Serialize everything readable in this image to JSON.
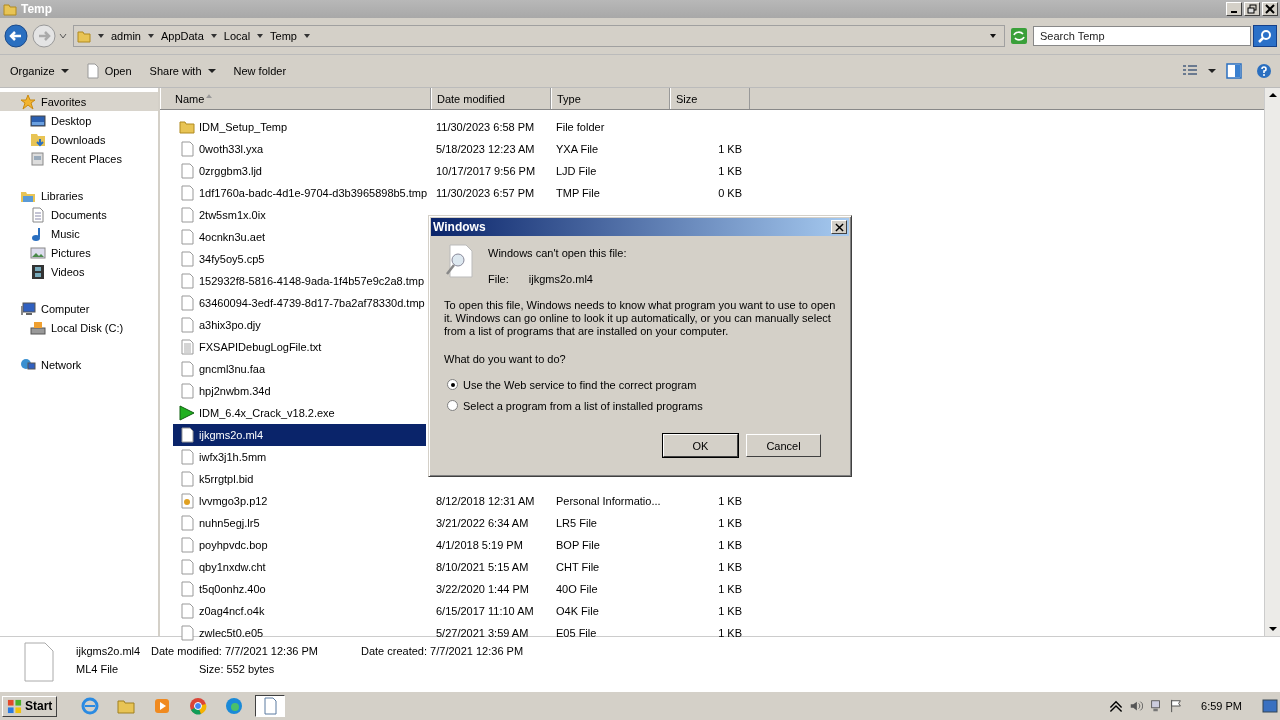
{
  "window": {
    "title": "Temp"
  },
  "address": {
    "crumbs": [
      "admin",
      "AppData",
      "Local",
      "Temp"
    ],
    "search_placeholder": "Search Temp"
  },
  "toolbar": [
    {
      "label": "Organize",
      "kind": "menu"
    },
    {
      "label": "Open",
      "kind": "open"
    },
    {
      "label": "Share with",
      "kind": "menu"
    },
    {
      "label": "New folder",
      "kind": "plain"
    }
  ],
  "sidebar": [
    {
      "label": "Favorites",
      "kind": "favorites",
      "selected": true,
      "children": [
        {
          "label": "Desktop",
          "kind": "desktop",
          "selected": false
        },
        {
          "label": "Downloads",
          "kind": "downloads",
          "selected": false
        },
        {
          "label": "Recent Places",
          "kind": "recent",
          "selected": false
        }
      ]
    },
    {
      "label": "Libraries",
      "kind": "libraries",
      "selected": false,
      "children": [
        {
          "label": "Documents",
          "kind": "documents",
          "selected": false
        },
        {
          "label": "Music",
          "kind": "music",
          "selected": false
        },
        {
          "label": "Pictures",
          "kind": "pictures",
          "selected": false
        },
        {
          "label": "Videos",
          "kind": "videos",
          "selected": false
        }
      ]
    },
    {
      "label": "Computer",
      "kind": "computer",
      "selected": false,
      "children": [
        {
          "label": "Local Disk (C:)",
          "kind": "disk",
          "selected": false
        }
      ]
    },
    {
      "label": "Network",
      "kind": "network",
      "selected": false
    }
  ],
  "table": {
    "columns": [
      "Name",
      "Date modified",
      "Type",
      "Size"
    ],
    "rows": [
      {
        "name": "IDM_Setup_Temp",
        "kind": "folder",
        "date": "11/30/2023 6:58 PM",
        "type": "File folder",
        "selected": false
      },
      {
        "name": "0woth33l.yxa",
        "kind": "file",
        "date": "5/18/2023 12:23 AM",
        "type": "YXA File",
        "size": "1 KB",
        "selected": false
      },
      {
        "name": "0zrggbm3.ljd",
        "kind": "file",
        "date": "10/17/2017 9:56 PM",
        "type": "LJD File",
        "size": "1 KB",
        "selected": false
      },
      {
        "name": "1df1760a-badc-4d1e-9704-d3b3965898b5.tmp",
        "kind": "file",
        "date": "11/30/2023 6:57 PM",
        "type": "TMP File",
        "size": "0 KB",
        "selected": false
      },
      {
        "name": "2tw5sm1x.0ix",
        "kind": "file",
        "selected": false
      },
      {
        "name": "4ocnkn3u.aet",
        "kind": "file",
        "selected": false
      },
      {
        "name": "34fy5oy5.cp5",
        "kind": "file",
        "selected": false
      },
      {
        "name": "152932f8-5816-4148-9ada-1f4b57e9c2a8.tmp",
        "kind": "file",
        "selected": false
      },
      {
        "name": "63460094-3edf-4739-8d17-7ba2af78330d.tmp",
        "kind": "file",
        "selected": false
      },
      {
        "name": "a3hix3po.djy",
        "kind": "file",
        "selected": false
      },
      {
        "name": "FXSAPIDebugLogFile.txt",
        "kind": "text",
        "selected": false
      },
      {
        "name": "gncml3nu.faa",
        "kind": "file",
        "selected": false
      },
      {
        "name": "hpj2nwbm.34d",
        "kind": "file",
        "selected": false
      },
      {
        "name": "IDM_6.4x_Crack_v18.2.exe",
        "kind": "exe",
        "selected": false
      },
      {
        "name": "ijkgms2o.ml4",
        "kind": "file",
        "selected": true
      },
      {
        "name": "iwfx3j1h.5mm",
        "kind": "file",
        "selected": false
      },
      {
        "name": "k5rrgtpl.bid",
        "kind": "file",
        "selected": false
      },
      {
        "name": "lvvmgo3p.p12",
        "kind": "cert",
        "date": "8/12/2018 12:31 AM",
        "type": "Personal Informatio...",
        "size": "1 KB",
        "selected": false
      },
      {
        "name": "nuhn5egj.lr5",
        "kind": "file",
        "date": "3/21/2022 6:34 AM",
        "type": "LR5 File",
        "size": "1 KB",
        "selected": false
      },
      {
        "name": "poyhpvdc.bop",
        "kind": "file",
        "date": "4/1/2018 5:19 PM",
        "type": "BOP File",
        "size": "1 KB",
        "selected": false
      },
      {
        "name": "qby1nxdw.cht",
        "kind": "file",
        "date": "8/10/2021 5:15 AM",
        "type": "CHT File",
        "size": "1 KB",
        "selected": false
      },
      {
        "name": "t5q0onhz.40o",
        "kind": "file",
        "date": "3/22/2020 1:44 PM",
        "type": "40O File",
        "size": "1 KB",
        "selected": false
      },
      {
        "name": "z0ag4ncf.o4k",
        "kind": "file",
        "date": "6/15/2017 11:10 AM",
        "type": "O4K File",
        "size": "1 KB",
        "selected": false
      },
      {
        "name": "zwlec5t0.e05",
        "kind": "file",
        "date": "5/27/2021 3:59 AM",
        "type": "E05 File",
        "size": "1 KB",
        "selected": false
      }
    ]
  },
  "details": {
    "name": "ijkgms2o.ml4",
    "type": "ML4 File",
    "fields": [
      {
        "label": "Date modified:",
        "value": "7/7/2021 12:36 PM"
      },
      {
        "label": "Date created:",
        "value": "7/7/2021 12:36 PM"
      },
      {
        "label": "Size:",
        "value": "552 bytes"
      }
    ]
  },
  "dialog": {
    "title": "Windows",
    "heading": "Windows can't open this file:",
    "file_label": "File:",
    "file_name": "ijkgms2o.ml4",
    "message": "To open this file, Windows needs to know what program you want to use to open it. Windows can go online to look it up automatically, or you can manually select from a list of programs that are installed on your computer.",
    "question": "What do you want to do?",
    "options": [
      {
        "label": "Use the Web service to find the correct program",
        "selected": true
      },
      {
        "label": "Select a program from a list of installed programs",
        "selected": false
      }
    ],
    "buttons": [
      {
        "label": "OK",
        "default": true
      },
      {
        "label": "Cancel",
        "default": false
      }
    ]
  },
  "taskbar": {
    "start": "Start",
    "apps": [
      {
        "kind": "ie",
        "active": false
      },
      {
        "kind": "explorer",
        "active": false
      },
      {
        "kind": "media",
        "active": false
      },
      {
        "kind": "chrome",
        "active": false
      },
      {
        "kind": "edge",
        "active": false
      },
      {
        "kind": "document",
        "active": true
      }
    ],
    "time": "6:59 PM"
  }
}
